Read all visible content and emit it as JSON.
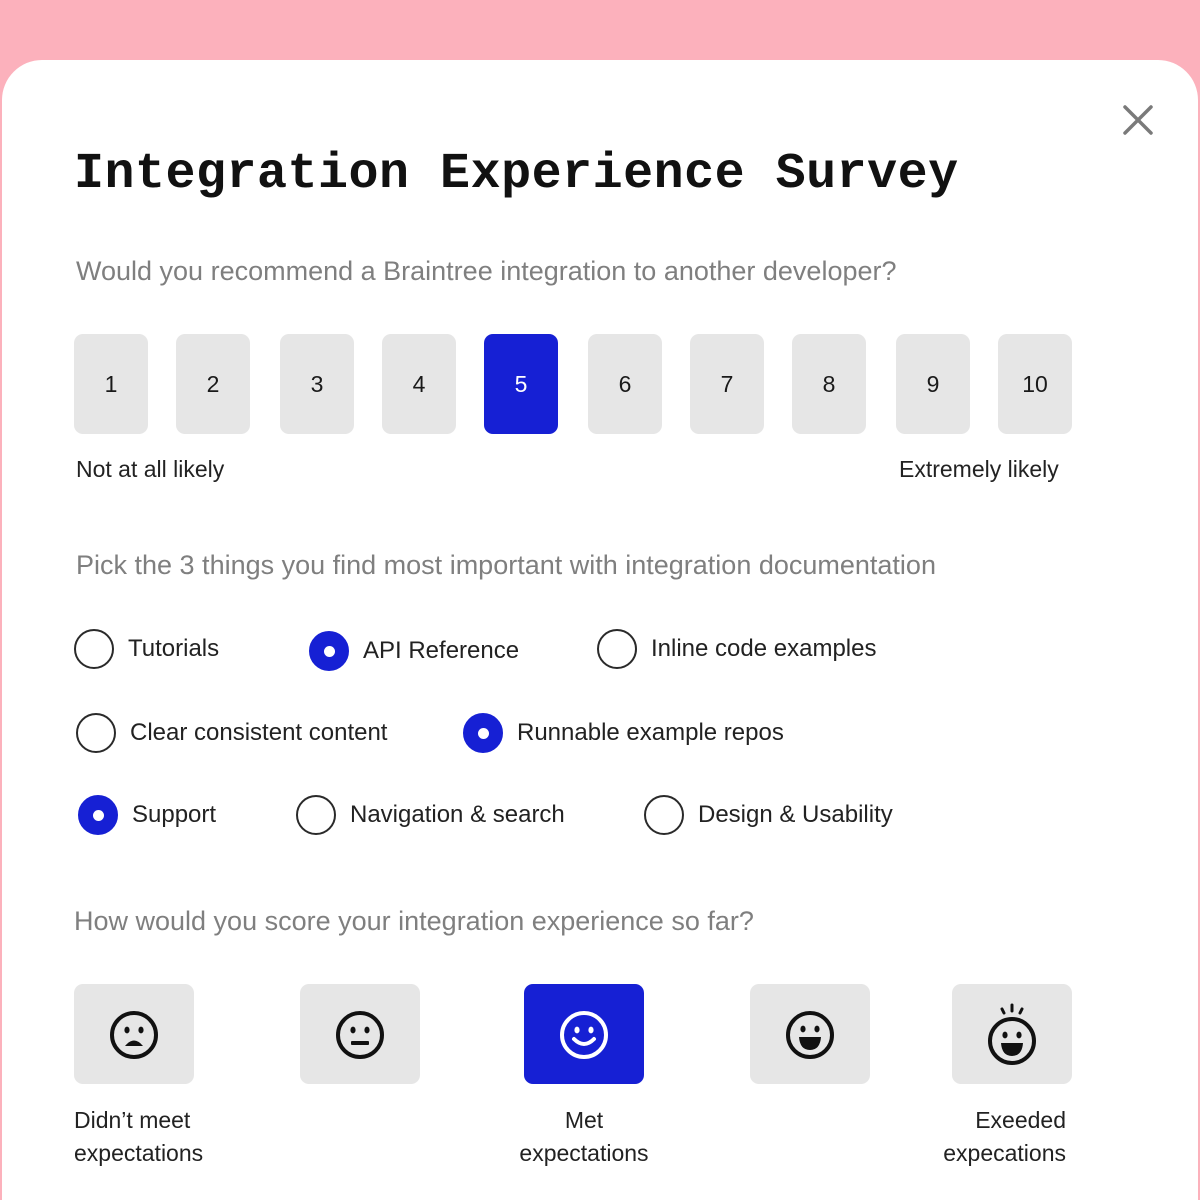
{
  "survey": {
    "title": "Integration Experience Survey",
    "close_icon": "close-icon",
    "accent_color": "#1620d4",
    "background_color": "#fcb1bc"
  },
  "recommend": {
    "question": "Would you recommend a Braintree integration to another developer?",
    "scale": [
      "1",
      "2",
      "3",
      "4",
      "5",
      "6",
      "7",
      "8",
      "9",
      "10"
    ],
    "selected": "5",
    "low_label": "Not at all likely",
    "high_label": "Extremely likely"
  },
  "importance": {
    "question": "Pick the 3 things you find most important with integration documentation",
    "options": [
      {
        "label": "Tutorials",
        "checked": false
      },
      {
        "label": "API Reference",
        "checked": true
      },
      {
        "label": "Inline code examples",
        "checked": false
      },
      {
        "label": "Clear consistent content",
        "checked": false
      },
      {
        "label": "Runnable example repos",
        "checked": true
      },
      {
        "label": "Support",
        "checked": true
      },
      {
        "label": "Navigation & search",
        "checked": false
      },
      {
        "label": "Design & Usability",
        "checked": false
      }
    ]
  },
  "score": {
    "question": "How would you score your integration experience so far?",
    "faces": [
      {
        "icon": "sad-face-icon",
        "selected": false
      },
      {
        "icon": "neutral-face-icon",
        "selected": false
      },
      {
        "icon": "smile-face-icon",
        "selected": true
      },
      {
        "icon": "happy-face-icon",
        "selected": false
      },
      {
        "icon": "excited-face-icon",
        "selected": false
      }
    ],
    "label_low_line1": "Didn’t meet",
    "label_low_line2": "expectations",
    "label_mid_line1": "Met",
    "label_mid_line2": "expectations",
    "label_high_line1": "Exeeded",
    "label_high_line2": "expecations"
  }
}
